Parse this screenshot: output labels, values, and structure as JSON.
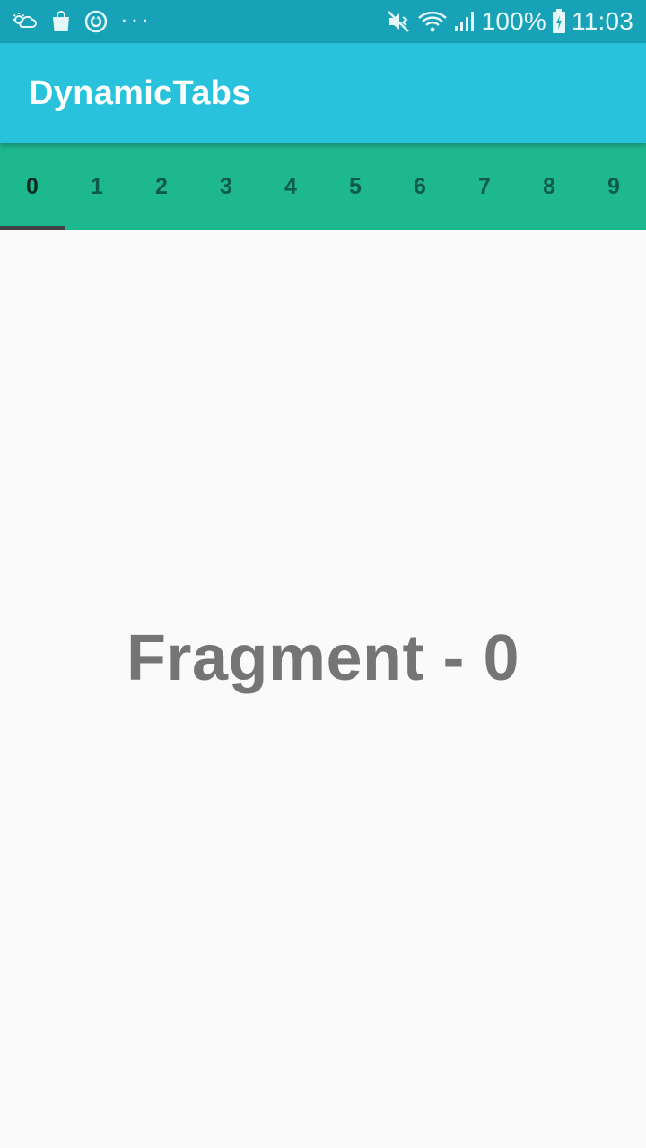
{
  "status_bar": {
    "battery": "100%",
    "time": "11:03",
    "more_indicator": "···",
    "icons_left": [
      "weather-icon",
      "shopping-bag-icon",
      "sync-icon"
    ],
    "icons_right": [
      "mute-icon",
      "wifi-icon",
      "signal-icon",
      "battery-icon"
    ]
  },
  "app_bar": {
    "title": "DynamicTabs",
    "color": "#29c2dd"
  },
  "tabs": {
    "color": "#1eb88e",
    "indicator_color": "#424242",
    "selected_index": 0,
    "items": [
      {
        "label": "0"
      },
      {
        "label": "1"
      },
      {
        "label": "2"
      },
      {
        "label": "3"
      },
      {
        "label": "4"
      },
      {
        "label": "5"
      },
      {
        "label": "6"
      },
      {
        "label": "7"
      },
      {
        "label": "8"
      },
      {
        "label": "9"
      }
    ]
  },
  "content": {
    "text": "Fragment - 0"
  }
}
